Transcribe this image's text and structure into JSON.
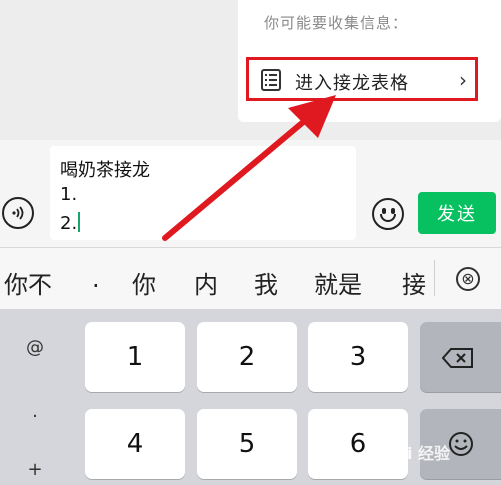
{
  "suggestion": {
    "title": "你可能要收集信息：",
    "item_label": "进入接龙表格",
    "chevron": "›",
    "icon": "list-icon"
  },
  "input": {
    "line1": "喝奶茶接龙",
    "line2": "1.",
    "line3": "2.",
    "voice_icon": "voice-icon",
    "emoji_icon": "emoji-icon",
    "send_label": "发送"
  },
  "candidates": [
    "你不",
    ".",
    "你",
    "内",
    "我",
    "就是",
    "接"
  ],
  "candidate_close_label": "⊗",
  "keyboard": {
    "side_keys": [
      "@",
      ".",
      "+"
    ],
    "row1": [
      "1",
      "2",
      "3"
    ],
    "row2": [
      "4",
      "5",
      "6"
    ]
  },
  "watermark": "Bai 经验",
  "colors": {
    "accent_green": "#07c160",
    "highlight_red": "#e0181f",
    "caret_green": "#19a56a"
  }
}
